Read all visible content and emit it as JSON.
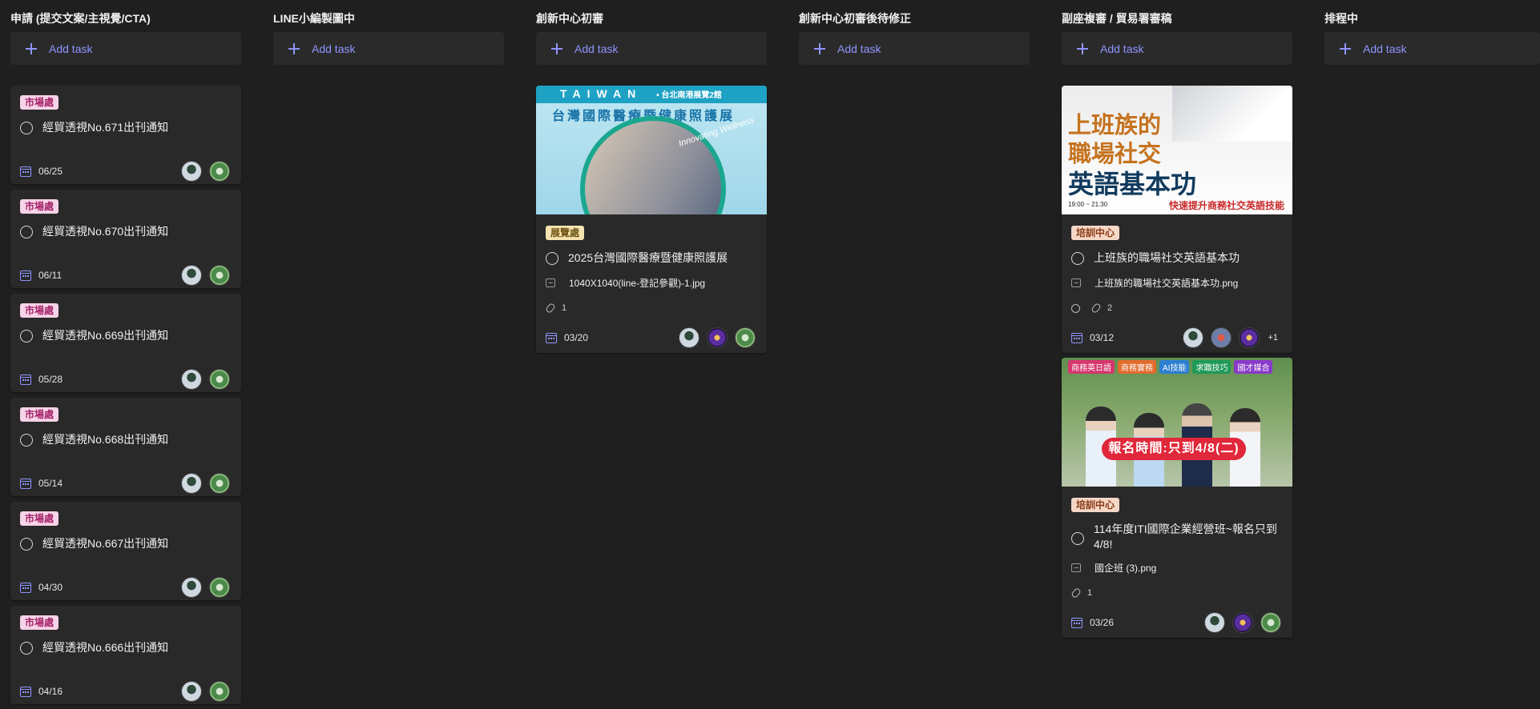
{
  "board": {
    "add_task_label": "Add task",
    "columns": [
      {
        "title": "申請 (提交文案/主視覺/CTA)",
        "cards": [
          {
            "tag": "市場處",
            "title": "經貿透視No.671出刊通知",
            "date": "06/25"
          },
          {
            "tag": "市場處",
            "title": "經貿透視No.670出刊通知",
            "date": "06/11"
          },
          {
            "tag": "市場處",
            "title": "經貿透視No.669出刊通知",
            "date": "05/28"
          },
          {
            "tag": "市場處",
            "title": "經貿透視No.668出刊通知",
            "date": "05/14"
          },
          {
            "tag": "市場處",
            "title": "經貿透視No.667出刊通知",
            "date": "04/30"
          },
          {
            "tag": "市場處",
            "title": "經貿透視No.666出刊通知",
            "date": "04/16"
          }
        ]
      },
      {
        "title": "LINE小編製圖中",
        "cards": []
      },
      {
        "title": "創新中心初審",
        "cards": [
          {
            "cover": {
              "band": "TAIWAN",
              "band_sub": "• 台北南港展覽2館",
              "headline": "台灣國際醫療暨健康照護展",
              "tagline": "Innovating Wellness"
            },
            "tag": "展覽處",
            "title": "2025台灣國際醫療暨健康照護展",
            "file": "1040X1040(line-登記參觀)-1.jpg",
            "attachments": "1",
            "date": "03/20"
          }
        ]
      },
      {
        "title": "創新中心初審後待修正",
        "cards": []
      },
      {
        "title": "副座複審 / 貿易署審稿",
        "cards": [
          {
            "cover": {
              "line1": "上班族的",
              "line2": "職場社交",
              "line3": "英語基本功",
              "strap": "快速提升商務社交英語技能",
              "time": "19:00 ~ 21:30"
            },
            "tag": "培訓中心",
            "title": "上班族的職場社交英語基本功",
            "file": "上班族的職場社交英語基本功.png",
            "attachments": "2",
            "date": "03/12",
            "more_assignees": "+1"
          },
          {
            "cover": {
              "chips": [
                "商務英日語",
                "商務實務",
                "AI技能",
                "求職技巧",
                "國才媒合"
              ],
              "banner": "報名時間:只到4/8(二)"
            },
            "tag": "培訓中心",
            "title": "114年度ITI國際企業經營班~報名只到4/8!",
            "file": "國企班 (3).png",
            "attachments": "1",
            "date": "03/26"
          }
        ]
      },
      {
        "title": "排程中",
        "cards": []
      }
    ]
  },
  "colors": {
    "background": "#1f1f1f",
    "card": "#292929",
    "accent": "#8f95ff",
    "tag_market": "#f7d3e8",
    "tag_expo": "#f4e3b0",
    "tag_training": "#f5d7c6"
  }
}
